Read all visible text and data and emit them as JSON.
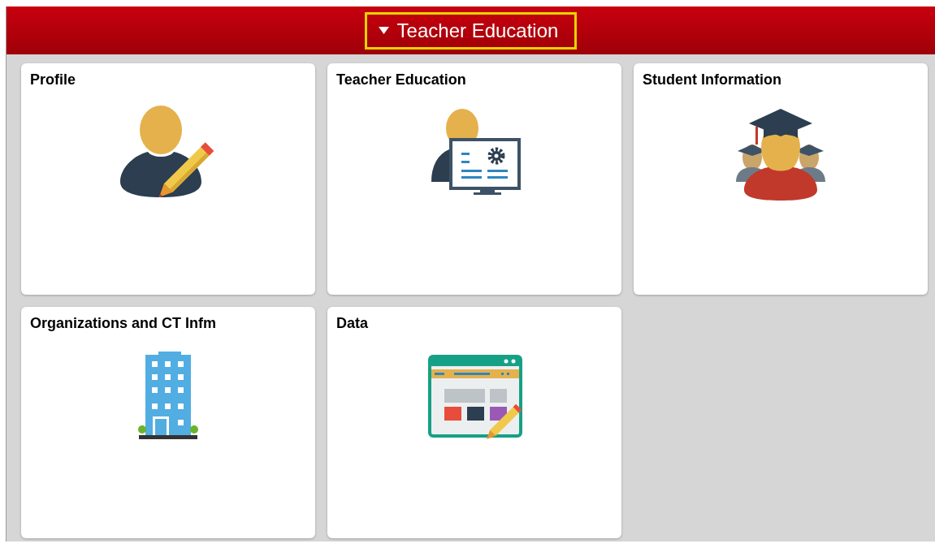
{
  "header": {
    "title": "Teacher Education"
  },
  "tiles": [
    {
      "title": "Profile",
      "kind": "profile"
    },
    {
      "title": "Teacher Education",
      "kind": "teacher"
    },
    {
      "title": "Student Information",
      "kind": "student"
    },
    {
      "title": "Organizations and CT Infm",
      "kind": "building"
    },
    {
      "title": "Data",
      "kind": "data"
    }
  ]
}
